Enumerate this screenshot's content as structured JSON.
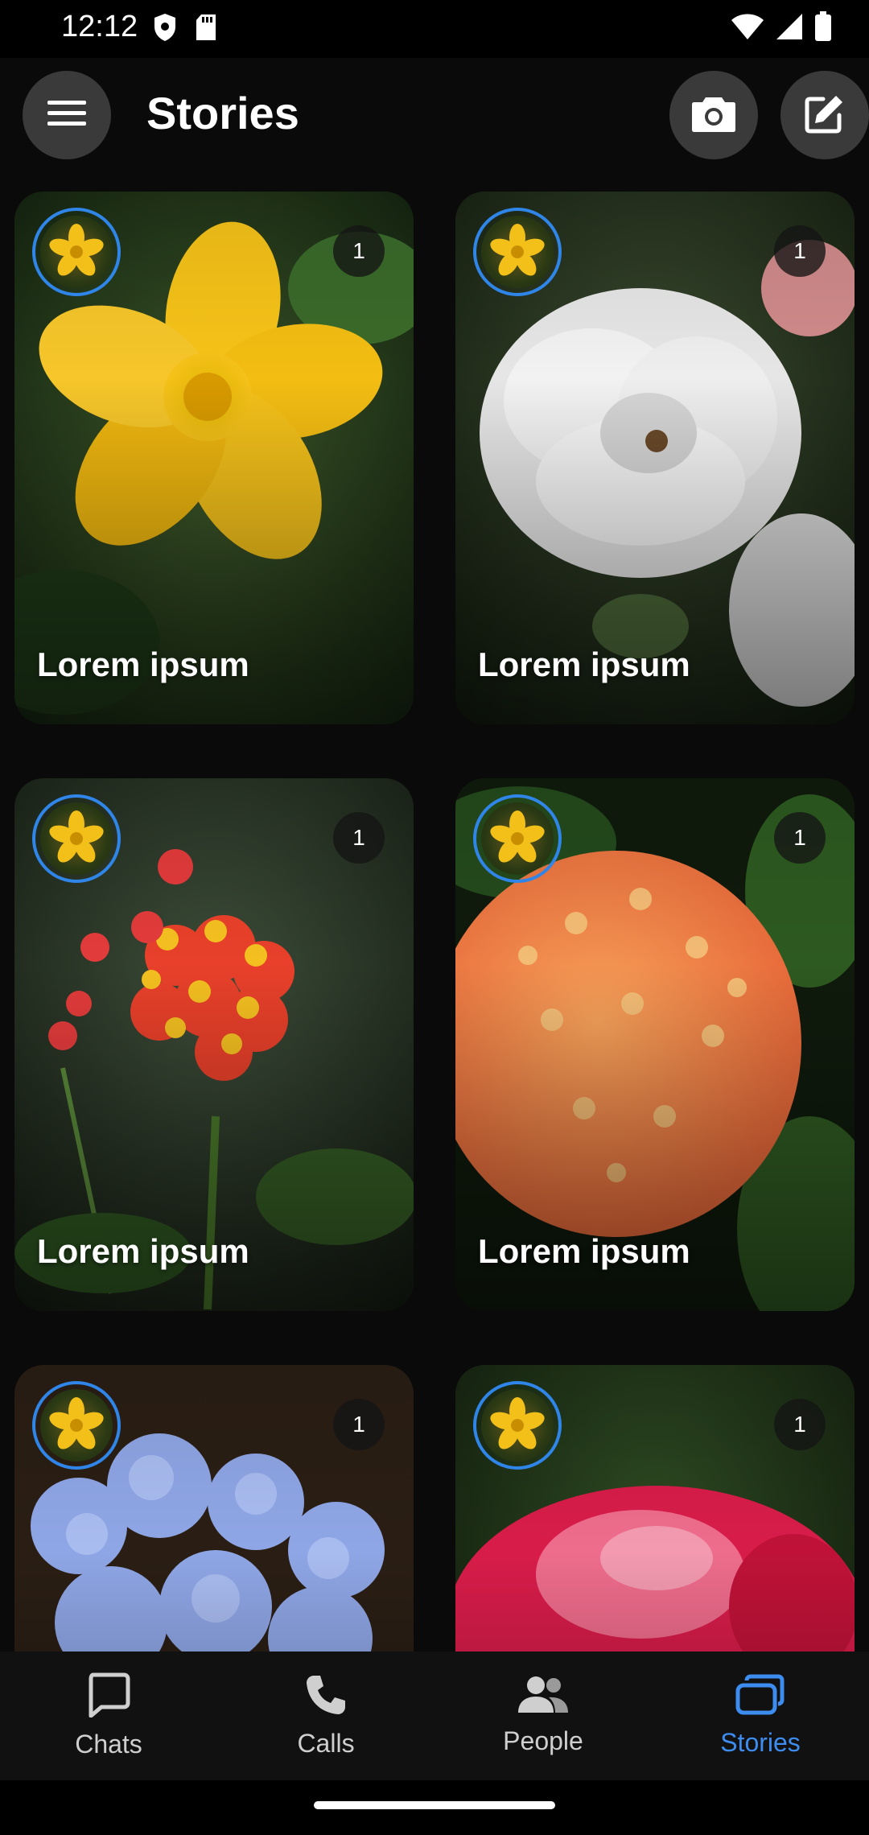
{
  "status_bar": {
    "time": "12:12"
  },
  "app_bar": {
    "title": "Stories",
    "menu_icon": "hamburger-menu-icon",
    "camera_icon": "camera-icon",
    "edit_icon": "edit-icon"
  },
  "stories": [
    {
      "label": "Lorem ipsum",
      "count": "1",
      "theme": "yellow-flower"
    },
    {
      "label": "Lorem ipsum",
      "count": "1",
      "theme": "white-rose"
    },
    {
      "label": "Lorem ipsum",
      "count": "1",
      "theme": "red-orange-milkweed"
    },
    {
      "label": "Lorem ipsum",
      "count": "1",
      "theme": "orange-ixora"
    },
    {
      "label": "",
      "count": "1",
      "theme": "blue-hydrangea"
    },
    {
      "label": "",
      "count": "1",
      "theme": "red-rose"
    }
  ],
  "bottom_nav": {
    "items": [
      {
        "label": "Chats",
        "icon": "chat-icon",
        "active": false
      },
      {
        "label": "Calls",
        "icon": "phone-icon",
        "active": false
      },
      {
        "label": "People",
        "icon": "people-icon",
        "active": false
      },
      {
        "label": "Stories",
        "icon": "stories-icon",
        "active": true
      }
    ]
  },
  "colors": {
    "accent": "#3d8cf0",
    "avatar_ring": "#2f86e8",
    "button_bg": "#3a3a3a"
  }
}
